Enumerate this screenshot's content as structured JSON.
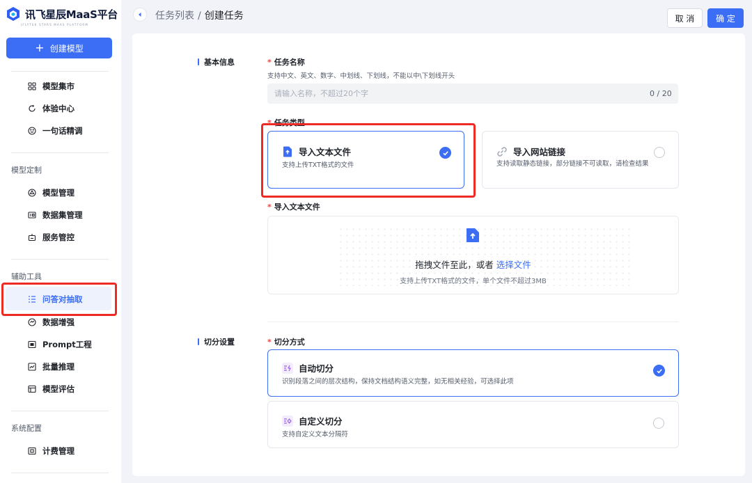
{
  "sidebar": {
    "logo_text": "讯飞星辰MaaS平台",
    "logo_subtitle": "IFLYTEK STARS MAAS PLATFORM",
    "create_button": "创建模型",
    "items": {
      "market": "模型集市",
      "experience": "体验中心",
      "one_sentence": "一句话精调",
      "model_manage": "模型管理",
      "dataset_manage": "数据集管理",
      "service_control": "服务管控",
      "qa_extract": "问答对抽取",
      "data_augment": "数据增强",
      "prompt": "Prompt工程",
      "batch_infer": "批量推理",
      "model_eval": "模型评估",
      "billing": "计费管理"
    },
    "groups": {
      "custom": "模型定制",
      "tools": "辅助工具",
      "system": "系统配置"
    }
  },
  "header": {
    "crumb_parent": "任务列表",
    "separator": "/",
    "crumb_current": "创建任务",
    "cancel": "取 消",
    "confirm": "确 定"
  },
  "form": {
    "basic_section": "基本信息",
    "split_section": "切分设置",
    "task_name_label": "任务名称",
    "task_name_hint": "支持中文、英文、数字、中划线、下划线，不能以中\\下划线开头",
    "task_name_placeholder": "请输入名称，不超过20个字",
    "task_name_counter": "0 / 20",
    "task_type_label": "任务类型",
    "task_types": [
      {
        "title": "导入文本文件",
        "desc": "支持上传TXT格式的文件",
        "selected": true
      },
      {
        "title": "导入网站链接",
        "desc": "支持读取静态链接，部分链接不可读取，请检查结果",
        "selected": false
      }
    ],
    "upload_label": "导入文本文件",
    "upload_main": "拖拽文件至此，或者",
    "upload_link": "选择文件",
    "upload_sub": "支持上传TXT格式的文件，单个文件不超过3MB",
    "split_label": "切分方式",
    "split_modes": [
      {
        "title": "自动切分",
        "desc": "识别段落之间的层次结构，保持文档结构语义完整，如无相关经验，可选择此项",
        "selected": true
      },
      {
        "title": "自定义切分",
        "desc": "支持自定义文本分隔符",
        "selected": false
      }
    ]
  },
  "colors": {
    "primary": "#3b6df5",
    "highlight_box": "#ee2a24",
    "required": "#e8473e"
  }
}
